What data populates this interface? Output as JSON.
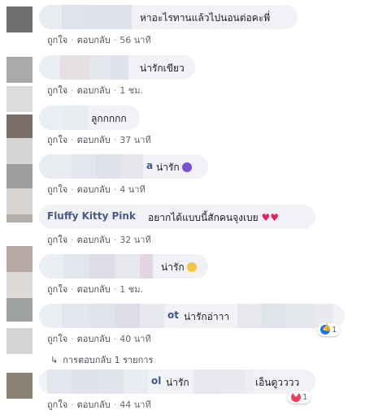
{
  "like_label": "ถูกใจ",
  "reply_label": "ตอบกลับ",
  "comments": [
    {
      "text": "หาอะไรทานแล้วไปนอนต่อคะพี่",
      "time": "56 นาที"
    },
    {
      "text": "น่ารักเขียว",
      "time": "1 ชม."
    },
    {
      "text": "ลูกกกกก",
      "time": "37 นาที"
    },
    {
      "name_tail": "a",
      "text": "น่ารัก",
      "time": "4 นาที"
    },
    {
      "name": "Fluffy Kitty Pink",
      "text": "อยากได้แบบนี้สักคนจุงเบย",
      "time": "32 นาที"
    },
    {
      "text": "น่ารัก",
      "time": "1 ชม."
    },
    {
      "name_tail": "ot",
      "text": "น่ารักอ่าาา",
      "time": "40 นาที",
      "reaction_count": "1"
    },
    {
      "name_tail": "ol",
      "text": "น่ารัก",
      "text2": "เอ็นดูวววว",
      "time": "44 นาที",
      "reaction_count": "1"
    }
  ],
  "replies_link": "การตอบกลับ 1 รายการ",
  "colors": {
    "link": "#385898",
    "meta": "#65676b",
    "bubble": "#f0f2f5",
    "heart": "#e0245e"
  },
  "icons": {
    "reply_arrow": "reply-arrow-icon",
    "like": "like-reaction-icon",
    "love": "love-reaction-icon",
    "heart": "heart-emoji-icon"
  }
}
